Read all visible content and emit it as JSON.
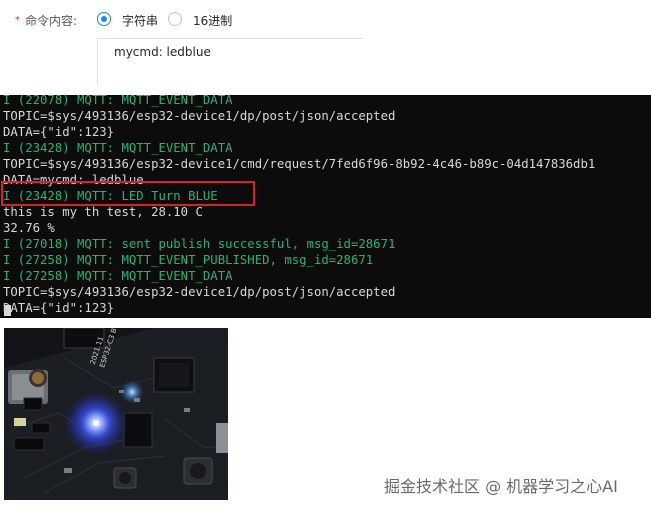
{
  "form": {
    "required_mark": "*",
    "label": "命令内容:",
    "options": [
      {
        "label": "字符串",
        "selected": true
      },
      {
        "label": "16进制",
        "selected": false
      }
    ],
    "command_value": "mycmd: ledblue"
  },
  "terminal": {
    "lines": [
      {
        "kind": "info",
        "text": "I (22078) MQTT: MQTT_EVENT_DATA"
      },
      {
        "kind": "plain",
        "text": "TOPIC=$sys/493136/esp32-device1/dp/post/json/accepted"
      },
      {
        "kind": "plain",
        "text": "DATA={\"id\":123}"
      },
      {
        "kind": "info",
        "text": "I (23428) MQTT: MQTT_EVENT_DATA"
      },
      {
        "kind": "plain",
        "text": "TOPIC=$sys/493136/esp32-device1/cmd/request/7fed6f96-8b92-4c46-b89c-04d147836db1"
      },
      {
        "kind": "plain",
        "text": "DATA=mycmd: ledblue"
      },
      {
        "kind": "info",
        "text": "I (23428) MQTT: LED Turn BLUE"
      },
      {
        "kind": "plain",
        "text": "this is my th test, 28.10 C"
      },
      {
        "kind": "plain",
        "text": "32.76 %"
      },
      {
        "kind": "info",
        "text": "I (27018) MQTT: sent publish successful, msg_id=28671"
      },
      {
        "kind": "info",
        "text": "I (27258) MQTT: MQTT_EVENT_PUBLISHED, msg_id=28671"
      },
      {
        "kind": "info",
        "text": "I (27258) MQTT: MQTT_EVENT_DATA"
      },
      {
        "kind": "plain",
        "text": "TOPIC=$sys/493136/esp32-device1/dp/post/json/accepted"
      },
      {
        "kind": "plain",
        "text": "DATA={\"id\":123}"
      }
    ],
    "highlight_color": "#e02020",
    "info_color": "#1fb777"
  },
  "photo": {
    "board_silkscreen": "ESP32-C3 BY OZH",
    "board_date": "2021.11",
    "led_color": "#4f6bff"
  },
  "watermark": "掘金技术社区 @ 机器学习之心AI",
  "colors": {
    "accent": "#1e88e5",
    "terminal_bg": "#0c0c0c"
  }
}
